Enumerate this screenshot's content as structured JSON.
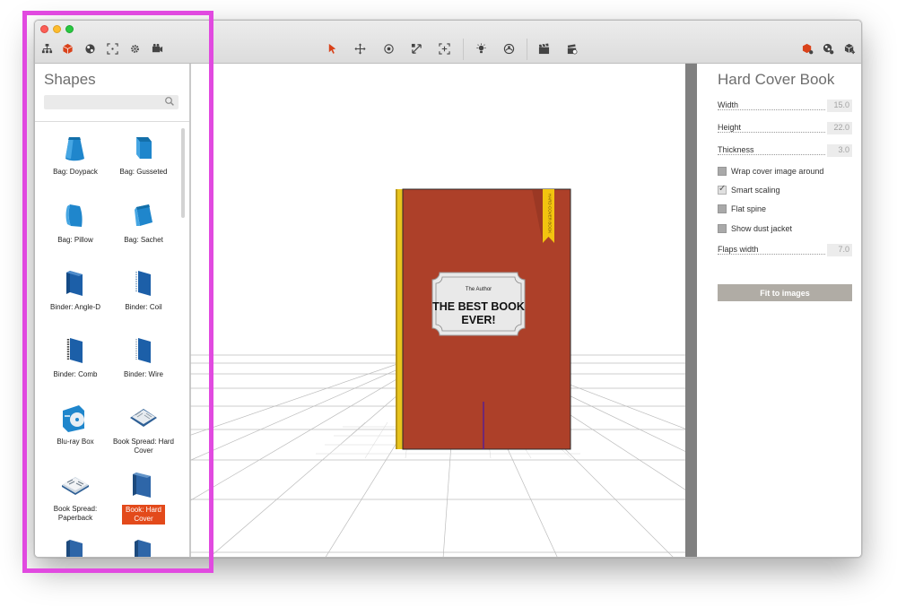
{
  "toolbar": {
    "left_tools": [
      {
        "icon": "hierarchy-icon"
      },
      {
        "icon": "cube-icon",
        "color": "#d9421a"
      },
      {
        "icon": "sphere-icon"
      },
      {
        "icon": "fit-frame-icon"
      },
      {
        "icon": "gear-icon"
      },
      {
        "icon": "camera-icon"
      }
    ],
    "center_tools": [
      {
        "icon": "select-arrow-icon",
        "color": "#d9421a"
      },
      {
        "icon": "move-icon"
      },
      {
        "icon": "rotate-icon"
      },
      {
        "icon": "scale-icon"
      },
      {
        "icon": "frame-selection-icon"
      },
      {
        "icon": "light-icon"
      },
      {
        "icon": "environment-icon"
      },
      {
        "icon": "clapper-icon"
      },
      {
        "icon": "render-icon"
      }
    ],
    "right_tools": [
      {
        "icon": "object-properties-icon",
        "color": "#d9421a"
      },
      {
        "icon": "material-icon"
      },
      {
        "icon": "add-object-icon"
      }
    ]
  },
  "shapes_panel": {
    "title": "Shapes",
    "search": {
      "placeholder": "",
      "value": ""
    },
    "items": [
      {
        "label": "Bag: Doypack",
        "icon": "bag-doypack-icon"
      },
      {
        "label": "Bag: Gusseted",
        "icon": "bag-gusseted-icon"
      },
      {
        "label": "Bag: Pillow",
        "icon": "bag-pillow-icon"
      },
      {
        "label": "Bag: Sachet",
        "icon": "bag-sachet-icon"
      },
      {
        "label": "Binder: Angle-D",
        "icon": "binder-angle-d-icon"
      },
      {
        "label": "Binder: Coil",
        "icon": "binder-coil-icon"
      },
      {
        "label": "Binder: Comb",
        "icon": "binder-comb-icon"
      },
      {
        "label": "Binder: Wire",
        "icon": "binder-wire-icon"
      },
      {
        "label": "Blu-ray Box",
        "icon": "bluray-box-icon"
      },
      {
        "label": "Book Spread: Hard Cover",
        "icon": "book-spread-hard-icon"
      },
      {
        "label": "Book Spread: Paperback",
        "icon": "book-spread-paperback-icon"
      },
      {
        "label": "Book: Hard Cover",
        "icon": "book-hard-cover-icon",
        "selected": true
      },
      {
        "label": "",
        "icon": "book-icon"
      },
      {
        "label": "",
        "icon": "book-icon"
      }
    ]
  },
  "viewport": {
    "book": {
      "author": "The Author",
      "title_line1": "THE BEST BOOK",
      "title_line2": "EVER!",
      "ribbon_text": "HARD COVER BOOK",
      "cover_color": "#ad4029",
      "spine_color": "#e8c41d",
      "ribbon_color": "#f2c40f"
    }
  },
  "properties_panel": {
    "title": "Hard Cover Book",
    "width": {
      "label": "Width",
      "value": "15.0"
    },
    "height": {
      "label": "Height",
      "value": "22.0"
    },
    "thickness": {
      "label": "Thickness",
      "value": "3.0"
    },
    "wrap_cover": {
      "label": "Wrap cover image around",
      "checked": false
    },
    "smart_scaling": {
      "label": "Smart scaling",
      "checked": true
    },
    "flat_spine": {
      "label": "Flat spine",
      "checked": false
    },
    "dust_jacket": {
      "label": "Show dust jacket",
      "checked": false
    },
    "flaps_width": {
      "label": "Flaps width",
      "value": "7.0"
    },
    "fit_button": "Fit to images"
  },
  "colors": {
    "accent": "#d9421a",
    "selection_bg": "#e34a1b",
    "highlight_frame": "#e14ae0"
  }
}
